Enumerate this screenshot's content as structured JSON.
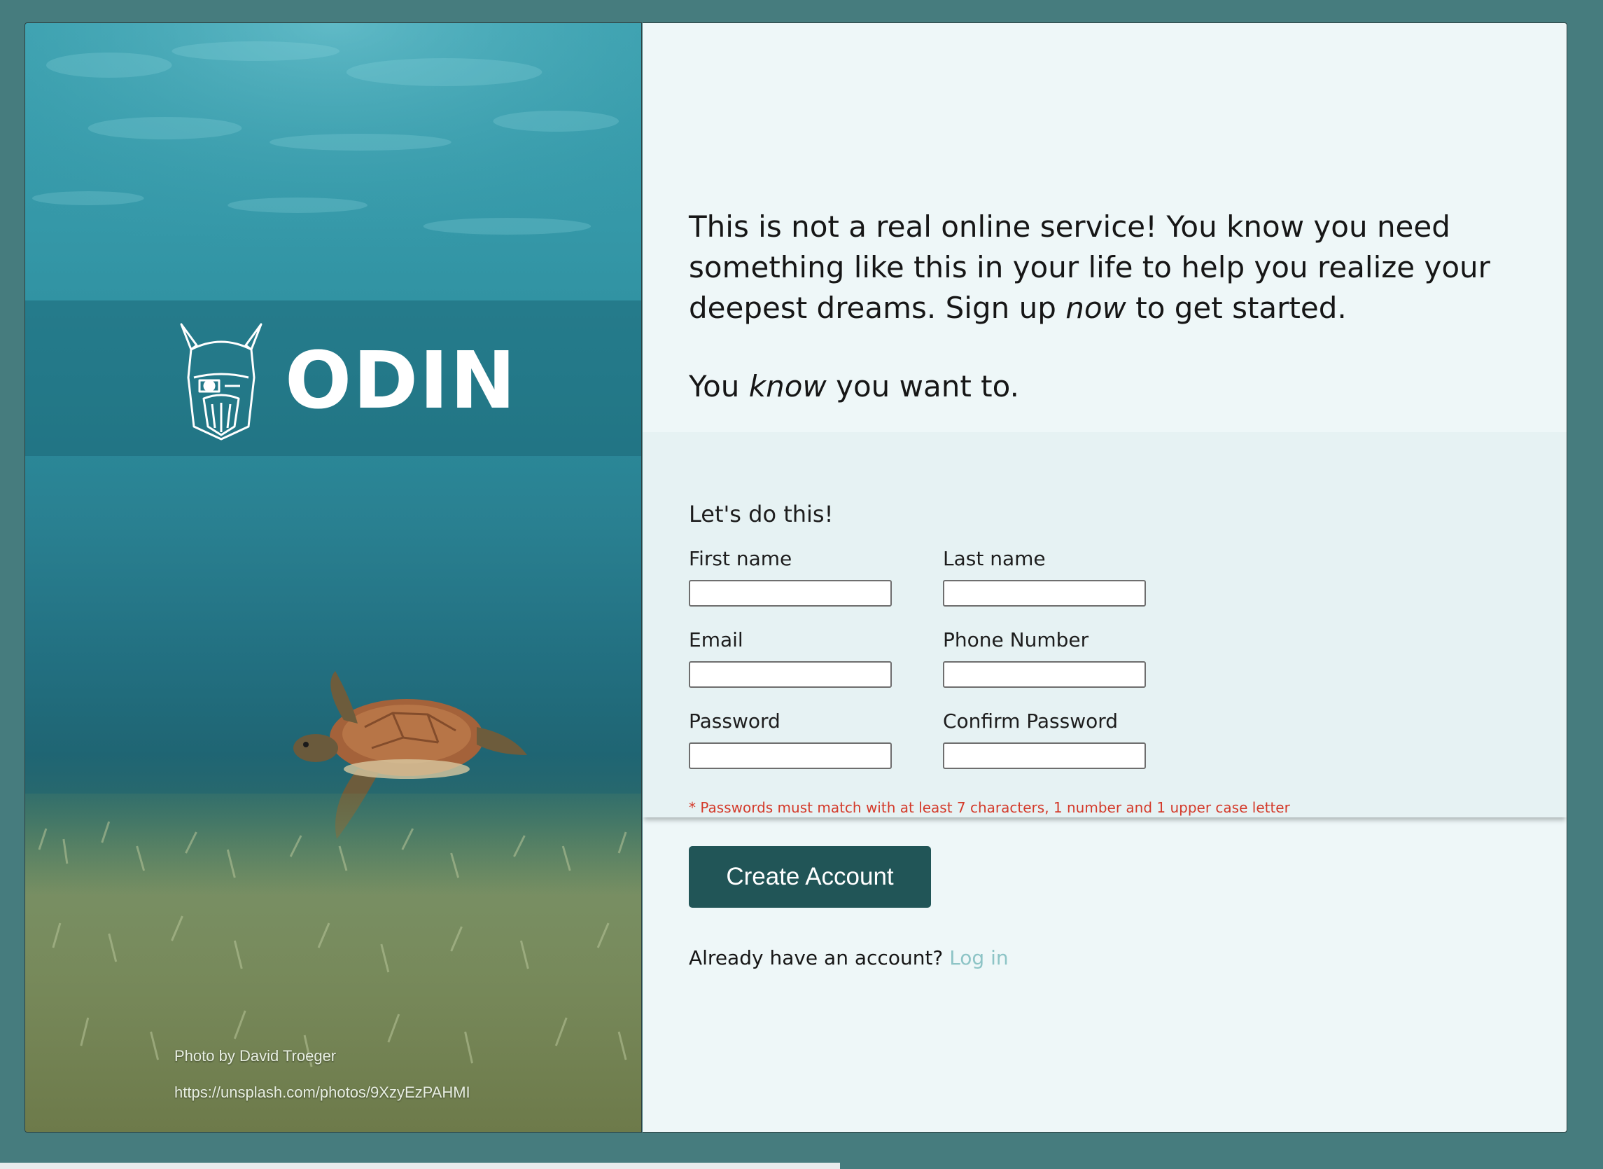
{
  "brand": {
    "logo_text": "ODIN"
  },
  "photo_credit": {
    "author": "Photo by David Troeger",
    "url": "https://unsplash.com/photos/9XzyEzPAHMI"
  },
  "intro": {
    "part1": "This is not a real online service! You know you need something like this in your life to help you realize your deepest dreams. Sign up ",
    "emphasis1": "now",
    "part2": " to get started.",
    "line2_part1": "You ",
    "line2_emphasis": "know",
    "line2_part2": " you want to."
  },
  "form": {
    "heading": "Let's do this!",
    "fields": {
      "first_name": {
        "label": "First name",
        "value": ""
      },
      "last_name": {
        "label": "Last name",
        "value": ""
      },
      "email": {
        "label": "Email",
        "value": ""
      },
      "phone": {
        "label": "Phone Number",
        "value": ""
      },
      "password": {
        "label": "Password",
        "value": ""
      },
      "confirm_password": {
        "label": "Confirm Password",
        "value": ""
      }
    },
    "password_hint": "* Passwords must match with at least 7 characters, 1 number and 1 upper case letter"
  },
  "actions": {
    "create_account": "Create Account",
    "login_prompt": "Already have an account?",
    "login_link": "Log in"
  },
  "colors": {
    "page_bg": "#467c7e",
    "button_bg": "#215557",
    "hint": "#d43a2a",
    "link": "#8dc4c6"
  }
}
